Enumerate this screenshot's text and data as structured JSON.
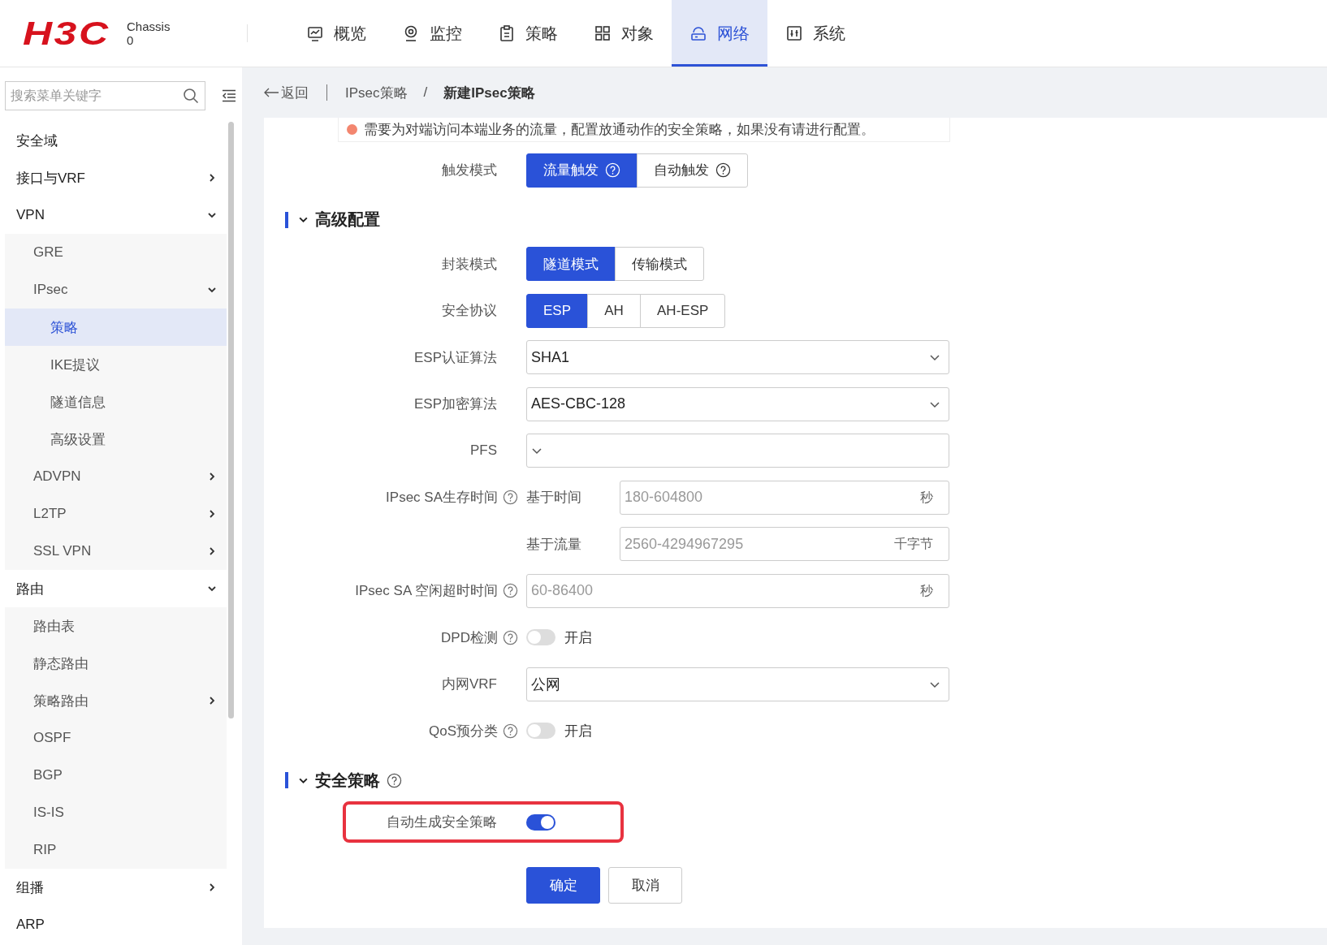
{
  "header": {
    "logo": "H3C",
    "chassis_label": "Chassis",
    "chassis_value": "0",
    "nav": [
      {
        "label": "概览",
        "selected": false
      },
      {
        "label": "监控",
        "selected": false
      },
      {
        "label": "策略",
        "selected": false
      },
      {
        "label": "对象",
        "selected": false
      },
      {
        "label": "网络",
        "selected": true
      },
      {
        "label": "系统",
        "selected": false
      }
    ]
  },
  "sidebar": {
    "search": {
      "placeholder": "搜索菜单关键字"
    },
    "items": [
      {
        "label": "安全域",
        "selected": false
      },
      {
        "label": "接口与VRF",
        "selected": false,
        "expanded": false
      },
      {
        "label": "VPN",
        "selected": false,
        "expanded": true,
        "children": [
          {
            "label": "GRE",
            "selected": false
          },
          {
            "label": "IPsec",
            "selected": false,
            "expanded": true,
            "children": [
              {
                "label": "策略",
                "selected": true
              },
              {
                "label": "IKE提议",
                "selected": false
              },
              {
                "label": "隧道信息",
                "selected": false
              },
              {
                "label": "高级设置",
                "selected": false
              }
            ]
          },
          {
            "label": "ADVPN",
            "selected": false,
            "expanded": false
          },
          {
            "label": "L2TP",
            "selected": false,
            "expanded": false
          },
          {
            "label": "SSL VPN",
            "selected": false,
            "expanded": false
          }
        ]
      },
      {
        "label": "路由",
        "selected": false,
        "expanded": true,
        "children": [
          {
            "label": "路由表",
            "selected": false
          },
          {
            "label": "静态路由",
            "selected": false
          },
          {
            "label": "策略路由",
            "selected": false,
            "expanded": false
          },
          {
            "label": "OSPF",
            "selected": false
          },
          {
            "label": "BGP",
            "selected": false
          },
          {
            "label": "IS-IS",
            "selected": false
          },
          {
            "label": "RIP",
            "selected": false
          }
        ]
      },
      {
        "label": "组播",
        "selected": false,
        "expanded": false
      },
      {
        "label": "ARP",
        "selected": false
      }
    ]
  },
  "breadcrumb": {
    "back": "返回",
    "items": [
      "IPsec策略",
      "新建IPsec策略"
    ],
    "separator": "/"
  },
  "notice": "需要为对端访问本端业务的流量，配置放通动作的安全策略，如果没有请进行配置。",
  "form": [
    {
      "kind": "segmented",
      "label": "触发模式",
      "options": [
        {
          "label": "流量触发",
          "help": true,
          "selected": true
        },
        {
          "label": "自动触发",
          "help": true,
          "selected": false
        }
      ]
    },
    {
      "kind": "section",
      "title": "高级配置",
      "expanded": true
    },
    {
      "kind": "segmented",
      "label": "封装模式",
      "options": [
        {
          "label": "隧道模式",
          "help": false,
          "selected": true
        },
        {
          "label": "传输模式",
          "help": false,
          "selected": false
        }
      ]
    },
    {
      "kind": "segmented",
      "label": "安全协议",
      "options": [
        {
          "label": "ESP",
          "help": false,
          "selected": true
        },
        {
          "label": "AH",
          "help": false,
          "selected": false
        },
        {
          "label": "AH-ESP",
          "help": false,
          "selected": false
        }
      ]
    },
    {
      "kind": "select",
      "label": "ESP认证算法",
      "value": "SHA1"
    },
    {
      "kind": "select",
      "label": "ESP加密算法",
      "value": "AES-CBC-128"
    },
    {
      "kind": "select",
      "label": "PFS"
    },
    {
      "kind": "input",
      "label": "IPsec SA生存时间",
      "help": true,
      "prefix": "基于时间",
      "placeholder": "180-604800",
      "unit": "秒"
    },
    {
      "kind": "input",
      "prefix": "基于流量",
      "placeholder": "2560-4294967295",
      "unit": "千字节"
    },
    {
      "kind": "input",
      "label": "IPsec SA 空闲超时时间",
      "help": true,
      "placeholder": "60-86400",
      "unit": "秒"
    },
    {
      "kind": "switch",
      "label": "DPD检测",
      "help": true,
      "on": false,
      "text": "开启"
    },
    {
      "kind": "select",
      "label": "内网VRF",
      "value": "公网"
    },
    {
      "kind": "switch",
      "label": "QoS预分类",
      "help": true,
      "on": false,
      "text": "开启"
    },
    {
      "kind": "section",
      "title": "安全策略",
      "expanded": true,
      "help": true
    },
    {
      "kind": "switch",
      "label": "自动生成安全策略",
      "on": true,
      "highlighted": true
    }
  ],
  "buttons": [
    {
      "label": "确定",
      "kind": "primary"
    },
    {
      "label": "取消",
      "kind": "default"
    }
  ]
}
